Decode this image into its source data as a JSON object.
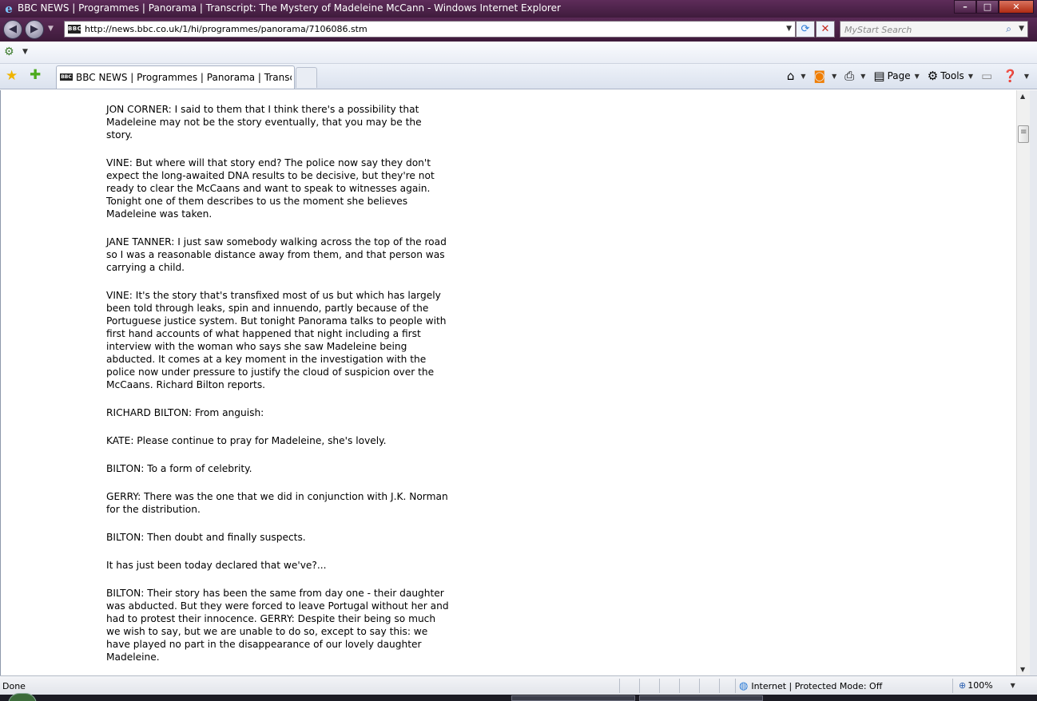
{
  "window": {
    "title": "BBC NEWS | Programmes | Panorama | Transcript: The Mystery of Madeleine McCann - Windows Internet Explorer",
    "minimize_glyph": "–",
    "maximize_glyph": "□",
    "close_glyph": "✕"
  },
  "address_bar": {
    "url": "http://news.bbc.co.uk/1/hi/programmes/panorama/7106086.stm",
    "favicon_text": "BBC"
  },
  "search": {
    "placeholder": "MyStart Search"
  },
  "tab": {
    "label": "BBC NEWS | Programmes | Panorama | Transcript...",
    "favicon_text": "BBC"
  },
  "command_bar": {
    "page_label": "Page",
    "tools_label": "Tools"
  },
  "transcript": [
    "JON CORNER: I said to them that I think there's a possibility that Madeleine may not be the story eventually, that you may be the story.",
    "VINE: But where will that story end? The police now say they don't expect the long-awaited DNA results to be decisive, but they're not ready to clear the McCaans and want to speak to witnesses again. Tonight one of them describes to us the moment she believes Madeleine was taken.",
    "JANE TANNER: I just saw somebody walking across the top of the road so I was a reasonable distance away from them, and that person was carrying a child.",
    "VINE: It's the story that's transfixed most of us but which has largely been told through leaks, spin and innuendo, partly because of the Portuguese justice system. But tonight Panorama talks to people with first hand accounts of what happened that night including a first interview with the woman who says she saw Madeleine being abducted. It comes at a key moment in the investigation with the police now under pressure to justify the cloud of suspicion over the McCaans. Richard Bilton reports.",
    "RICHARD BILTON: From anguish:",
    "KATE: Please continue to pray for Madeleine, she's lovely.",
    "BILTON: To a form of celebrity.",
    "GERRY: There was the one that we did in conjunction with J.K. Norman for the distribution.",
    "BILTON: Then doubt and finally suspects.",
    "It has just been today declared that we've?...",
    "BILTON: Their story has been the same from day one - their daughter was abducted. But they were forced to leave Portugal without her and had to protest their innocence. GERRY: Despite their being so much we wish to say, but we are unable to do so, except to say this: we have played no part in the disappearance of our lovely daughter Madeleine."
  ],
  "status_bar": {
    "status": "Done",
    "zone": "Internet | Protected Mode: Off",
    "zoom": "100%"
  },
  "colors": {
    "titlebar": "#4a2146",
    "accent": "#2a7bd8"
  },
  "icons": [
    "ie-logo-icon",
    "back-icon",
    "forward-icon",
    "refresh-icon",
    "stop-icon",
    "search-icon",
    "favorites-star-icon",
    "add-favorites-icon",
    "home-icon",
    "feeds-icon",
    "print-icon",
    "page-icon",
    "tools-gear-icon",
    "help-icon",
    "globe-icon",
    "zoom-icon"
  ]
}
